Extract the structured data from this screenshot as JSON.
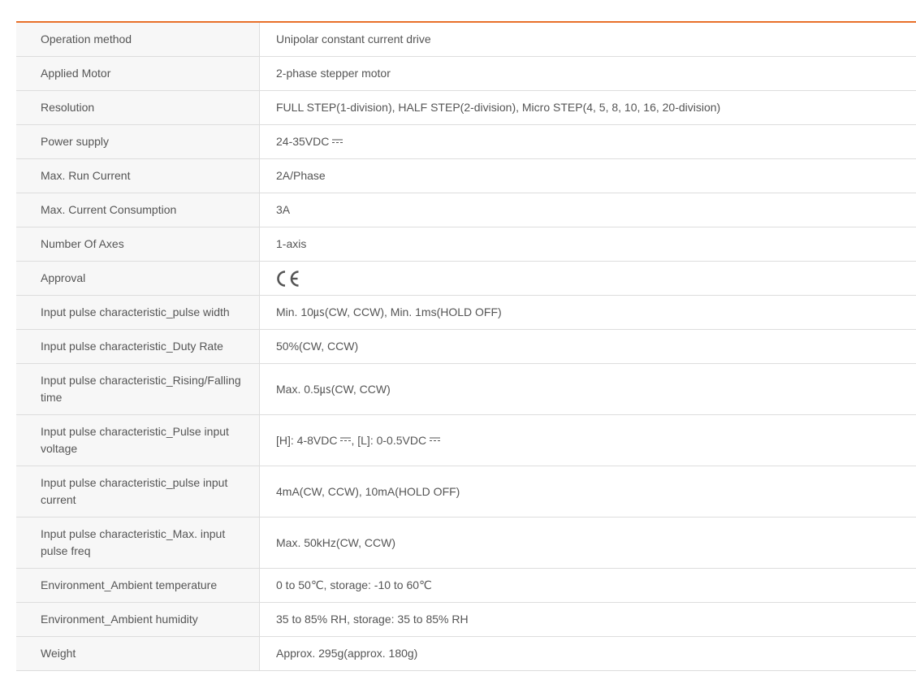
{
  "specs": [
    {
      "label": "Operation method",
      "value": "Unipolar constant current drive"
    },
    {
      "label": "Applied Motor",
      "value": "2-phase stepper motor"
    },
    {
      "label": "Resolution",
      "value": "FULL STEP(1-division), HALF STEP(2-division), Micro STEP(4, 5, 8, 10, 16, 20-division)"
    },
    {
      "label": "Power supply",
      "value": "24-35VDC"
    },
    {
      "label": "Max. Run Current",
      "value": "2A/Phase"
    },
    {
      "label": "Max. Current Consumption",
      "value": "3A"
    },
    {
      "label": "Number Of Axes",
      "value": "1-axis"
    },
    {
      "label": "Approval",
      "value": "CE"
    },
    {
      "label": "Input pulse characteristic_pulse width",
      "value": "Min. 10㎲(CW, CCW), Min. 1ms(HOLD OFF)"
    },
    {
      "label": "Input pulse characteristic_Duty Rate",
      "value": "50%(CW, CCW)"
    },
    {
      "label": "Input pulse characteristic_Rising/Falling time",
      "value": "Max. 0.5㎲(CW, CCW)"
    },
    {
      "label": "Input pulse characteristic_Pulse input voltage",
      "value_part1": "[H]: 4-8VDC",
      "value_part2": ", [L]: 0-0.5VDC"
    },
    {
      "label": "Input pulse characteristic_pulse input current",
      "value": "4mA(CW, CCW), 10mA(HOLD OFF)"
    },
    {
      "label": "Input pulse characteristic_Max. input pulse freq",
      "value": "Max. 50kHz(CW, CCW)"
    },
    {
      "label": "Environment_Ambient temperature",
      "value": "0 to 50℃, storage: -10 to 60℃"
    },
    {
      "label": "Environment_Ambient humidity",
      "value": "35 to 85% RH, storage: 35 to 85% RH"
    },
    {
      "label": "Weight",
      "value": "Approx. 295g(approx. 180g)"
    }
  ],
  "colors": {
    "accent": "#e8702a",
    "label_bg": "#f7f7f7",
    "border": "#dddddd",
    "text": "#555555"
  }
}
